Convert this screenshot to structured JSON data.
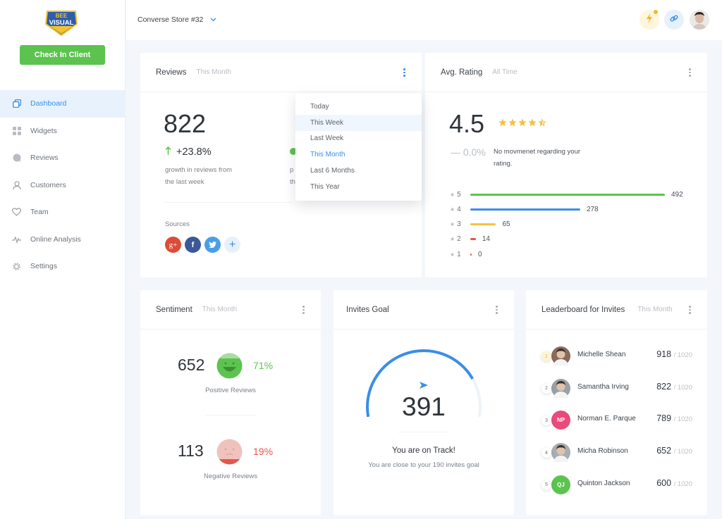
{
  "app": {
    "logo_line1": "BEE",
    "logo_line2": "VISUAL",
    "checkin_label": "Check In Client"
  },
  "sidebar": {
    "items": [
      {
        "label": "Dashboard",
        "icon": "dashboard-icon",
        "active": true
      },
      {
        "label": "Widgets",
        "icon": "widgets-icon"
      },
      {
        "label": "Reviews",
        "icon": "chat-bubble-icon"
      },
      {
        "label": "Customers",
        "icon": "user-icon"
      },
      {
        "label": "Team",
        "icon": "heart-icon"
      },
      {
        "label": "Online Analysis",
        "icon": "pulse-icon"
      },
      {
        "label": "Settings",
        "icon": "gear-icon"
      }
    ]
  },
  "topbar": {
    "store": "Converse Store #32",
    "colors": {
      "bolt_bg": "#fdf5dc",
      "link_bg": "#e6f1fd"
    }
  },
  "reviews": {
    "title": "Reviews",
    "period": "This Month",
    "count": "822",
    "change": "+23.8%",
    "desc_line1": "growth in reviews from",
    "desc_line2": "the last week",
    "hidden_line1": "p",
    "hidden_line2": "th",
    "sources_label": "Sources",
    "sources": [
      {
        "name": "google-plus",
        "glyph": "g+",
        "color": "#dd4b39"
      },
      {
        "name": "facebook",
        "glyph": "f",
        "color": "#3b5998"
      },
      {
        "name": "twitter",
        "glyph": "t",
        "color": "#4a9ee8"
      },
      {
        "name": "add-source",
        "glyph": "+",
        "color": "#e6f1fd"
      }
    ]
  },
  "period_menu": {
    "items": [
      "Today",
      "This Week",
      "Last Week",
      "This Month",
      "Last 6 Months",
      "This Year"
    ],
    "hover": "This Week",
    "selected": "This Month"
  },
  "rating": {
    "title": "Avg. Rating",
    "period": "All Time",
    "value": "4.5",
    "stars": 4.5,
    "change": "— 0.0%",
    "desc_line1": "No movmenet regarding your",
    "desc_line2": "rating.",
    "breakdown": [
      {
        "star": "5",
        "count": 492,
        "color": "#5cc34f"
      },
      {
        "star": "4",
        "count": 278,
        "color": "#3a8ee6"
      },
      {
        "star": "3",
        "count": 65,
        "color": "#f5c142"
      },
      {
        "star": "2",
        "count": 14,
        "color": "#e2574c"
      },
      {
        "star": "1",
        "count": 0,
        "color": "#e2574c"
      }
    ]
  },
  "sentiment": {
    "title": "Sentiment",
    "period": "This Month",
    "positive": {
      "count": "652",
      "pct": "71%",
      "label": "Positive Reviews",
      "color": "#5cc34f"
    },
    "negative": {
      "count": "113",
      "pct": "19%",
      "label": "Negative Reviews",
      "color": "#e2574c"
    }
  },
  "invites": {
    "title": "Invites Goal",
    "value": "391",
    "progress": 0.8,
    "headline": "You are on Track!",
    "sub": "You are close to your 190 invites goal"
  },
  "leaderboard": {
    "title": "Leaderboard for Invites",
    "period": "This Month",
    "rows": [
      {
        "rank": "1",
        "name": "Michelle Shean",
        "score": "918",
        "total": "/ 1020",
        "initials": "",
        "color": "#8a6a5a"
      },
      {
        "rank": "2",
        "name": "Samantha Irving",
        "score": "822",
        "total": "/ 1020",
        "initials": "",
        "color": "#9aa0a6"
      },
      {
        "rank": "3",
        "name": "Norman E. Parque",
        "score": "789",
        "total": "/ 1020",
        "initials": "NP",
        "color": "#e94b7b"
      },
      {
        "rank": "4",
        "name": "Micha Robinson",
        "score": "652",
        "total": "/ 1020",
        "initials": "",
        "color": "#a8adb2"
      },
      {
        "rank": "5",
        "name": "Quinton Jackson",
        "score": "600",
        "total": "/ 1020",
        "initials": "QJ",
        "color": "#5cc34f"
      }
    ]
  }
}
